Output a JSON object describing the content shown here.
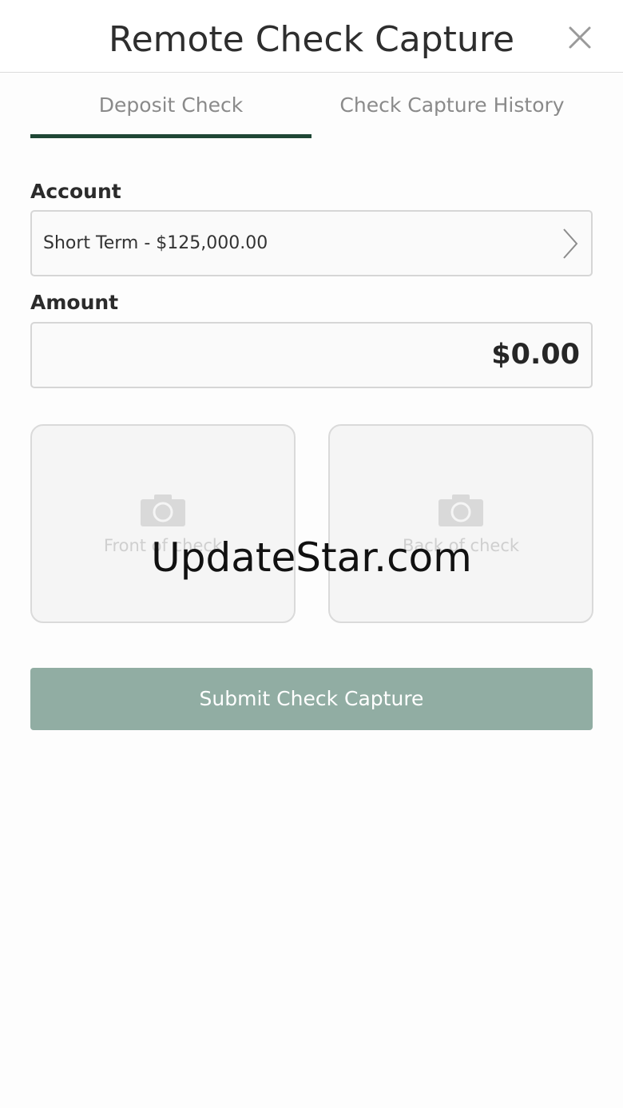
{
  "header": {
    "title": "Remote Check Capture",
    "close_icon": "close-icon"
  },
  "tabs": [
    {
      "label": "Deposit Check",
      "active": true
    },
    {
      "label": "Check Capture History",
      "active": false
    }
  ],
  "form": {
    "account_label": "Account",
    "account_value": "Short Term - $125,000.00",
    "amount_label": "Amount",
    "amount_value": "$0.00"
  },
  "photos": {
    "front_label": "Front of check",
    "back_label": "Back of check",
    "icon": "camera-icon"
  },
  "submit_label": "Submit Check Capture",
  "watermark": "UpdateStar.com",
  "colors": {
    "accent": "#1f4735",
    "button": "#91ada3"
  }
}
